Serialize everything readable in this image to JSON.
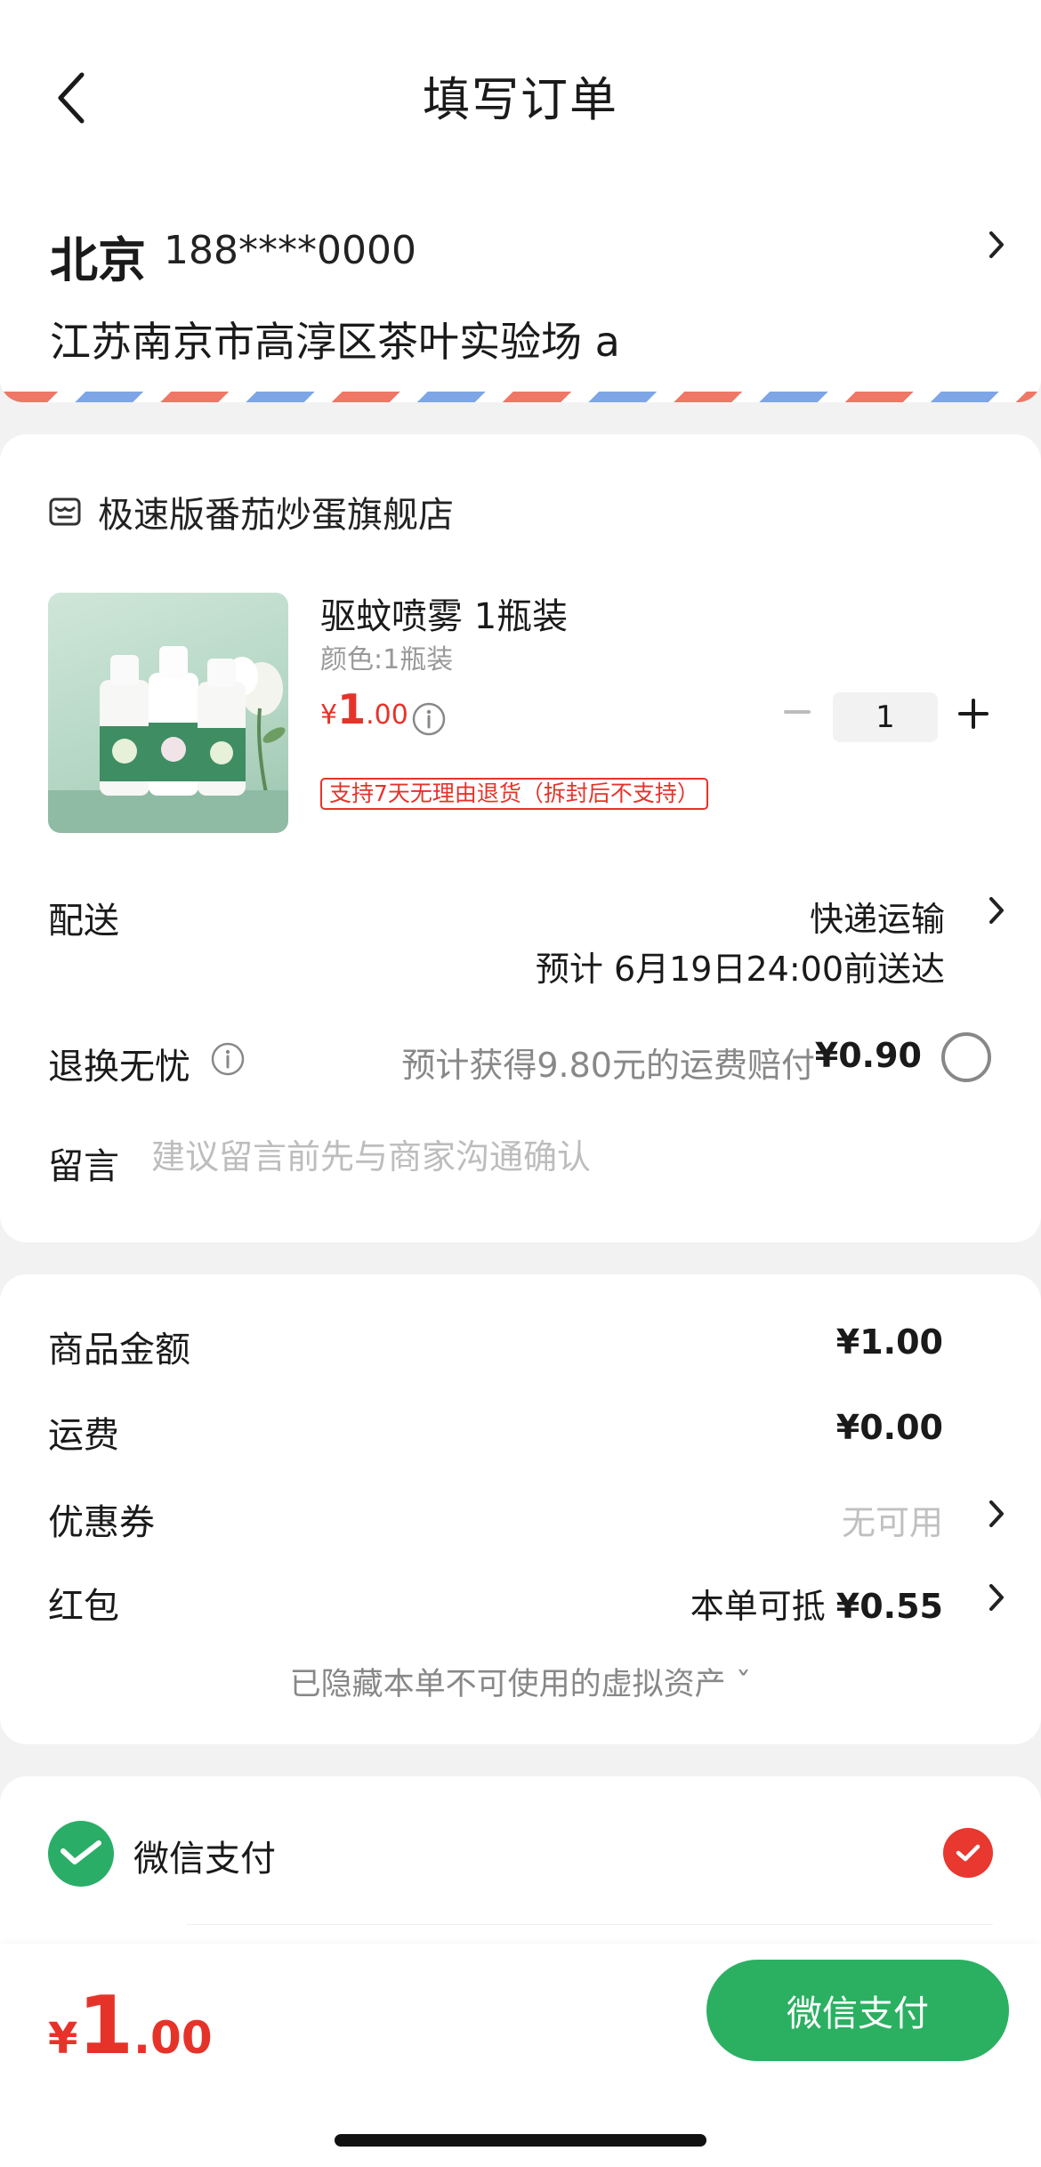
{
  "header": {
    "title": "填写订单"
  },
  "address": {
    "name": "北京",
    "phone": "188****0000",
    "line": "江苏南京市高淳区茶叶实验场 a"
  },
  "store": {
    "name": "极速版番茄炒蛋旗舰店",
    "product": {
      "title": "驱蚊喷雾 1瓶装",
      "spec": "颜色:1瓶装",
      "price_currency": "¥",
      "price_int": "1",
      "price_dec": ".00",
      "quantity": "1",
      "return_policy": "支持7天无理由退货（拆封后不支持）"
    },
    "delivery": {
      "label": "配送",
      "method": "快递运输",
      "estimate": "预计 6月19日24:00前送达"
    },
    "worry_free": {
      "label": "退换无忧",
      "text": "预计获得9.80元的运费赔付",
      "price": "¥0.90",
      "selected": false
    },
    "note": {
      "label": "留言",
      "placeholder": "建议留言前先与商家沟通确认"
    }
  },
  "summary": {
    "goods_label": "商品金额",
    "goods_value": "¥1.00",
    "shipping_label": "运费",
    "shipping_value": "¥0.00",
    "coupon_label": "优惠券",
    "coupon_value": "无可用",
    "redpacket_label": "红包",
    "redpacket_prefix": "本单可抵",
    "redpacket_value": "¥0.55",
    "hidden_note": "已隐藏本单不可使用的虚拟资产 ˇ"
  },
  "payment": {
    "method": "微信支付",
    "selected": true
  },
  "footer": {
    "total_currency": "¥",
    "total_int": "1",
    "total_dec": ".00",
    "pay_button": "微信支付"
  },
  "colors": {
    "price_red": "#e6332a",
    "wechat_green": "#2bb061",
    "check_red": "#e8382f"
  }
}
